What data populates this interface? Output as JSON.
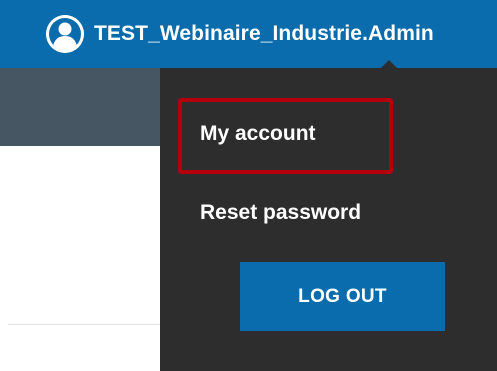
{
  "header": {
    "username": "TEST_Webinaire_Industrie.Admin",
    "avatar_icon": "user-avatar-icon",
    "background_color": "#0a6cad"
  },
  "user_menu": {
    "items": [
      {
        "label": "My account"
      },
      {
        "label": "Reset password"
      }
    ],
    "logout_label": "LOG OUT",
    "background_color": "#2d2d2d",
    "highlight_color": "#b3000c"
  }
}
